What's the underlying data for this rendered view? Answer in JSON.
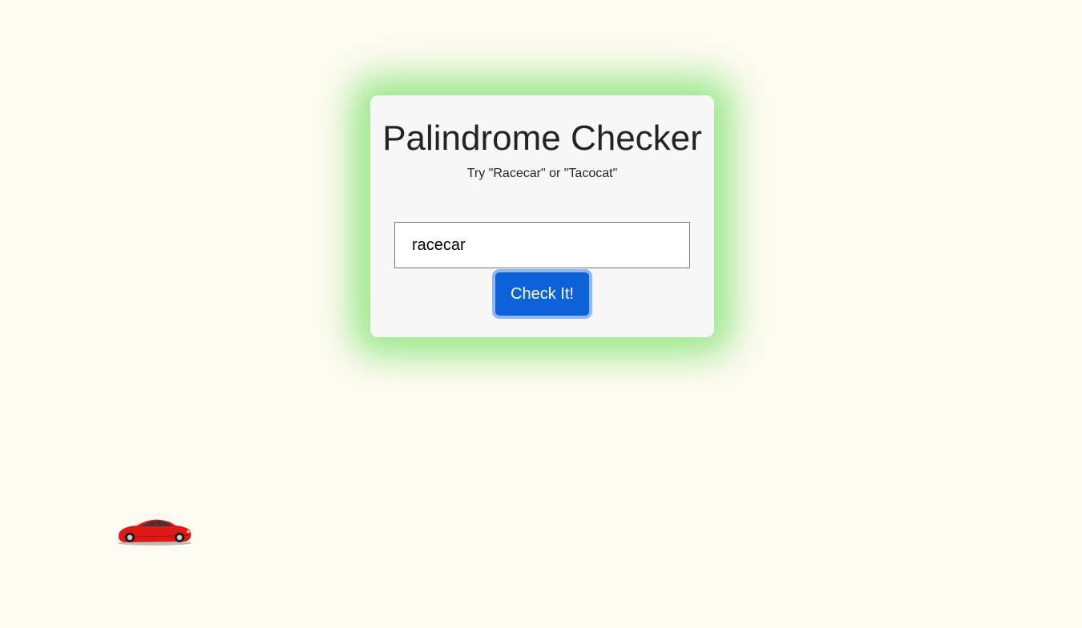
{
  "checker": {
    "title": "Palindrome Checker",
    "subtitle": "Try \"Racecar\" or \"Tacocat\"",
    "input_value": "racecar",
    "button_label": "Check It!"
  },
  "colors": {
    "page_background": "#fefbf2",
    "card_background": "#f7f7f7",
    "card_glow": "#76e066",
    "button_background": "#0d61d9",
    "button_focus_ring": "#8fb8f0",
    "car_body": "#e01818"
  },
  "decorations": {
    "car_icon": "red-sports-car-icon"
  }
}
